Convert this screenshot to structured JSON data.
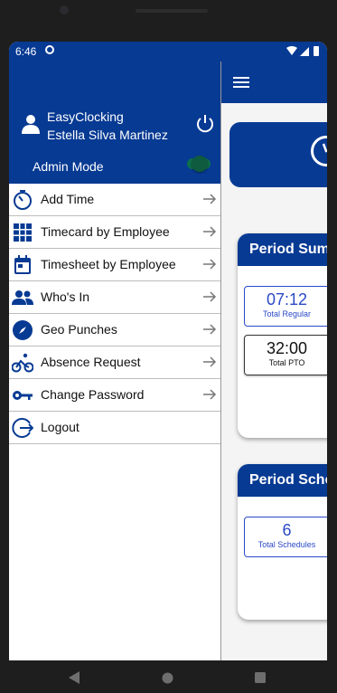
{
  "status_bar": {
    "time": "6:46"
  },
  "drawer": {
    "app_name": "EasyClocking",
    "user_name": "Estella Silva Martinez",
    "admin_mode_label": "Admin Mode",
    "admin_mode_on": true,
    "items": [
      {
        "label": "Add Time",
        "icon": "timer-icon"
      },
      {
        "label": "Timecard by Employee",
        "icon": "grid-icon"
      },
      {
        "label": "Timesheet by Employee",
        "icon": "calendar-icon"
      },
      {
        "label": "Who's In",
        "icon": "people-icon"
      },
      {
        "label": "Geo Punches",
        "icon": "compass-icon"
      },
      {
        "label": "Absence Request",
        "icon": "bike-icon"
      },
      {
        "label": "Change Password",
        "icon": "key-icon"
      },
      {
        "label": "Logout",
        "icon": "logout-icon"
      }
    ]
  },
  "main": {
    "period_summary": {
      "title": "Period Summary",
      "stats": [
        {
          "value": "07:12",
          "label": "Total Regular"
        },
        {
          "value": "32:00",
          "label": "Total PTO"
        }
      ]
    },
    "period_schedules": {
      "title": "Period Schedules",
      "stats": [
        {
          "value": "6",
          "label": "Total Schedules"
        }
      ]
    }
  },
  "colors": {
    "primary": "#073a93",
    "accent": "#2b49c7",
    "toggle": "#0e5b40"
  }
}
